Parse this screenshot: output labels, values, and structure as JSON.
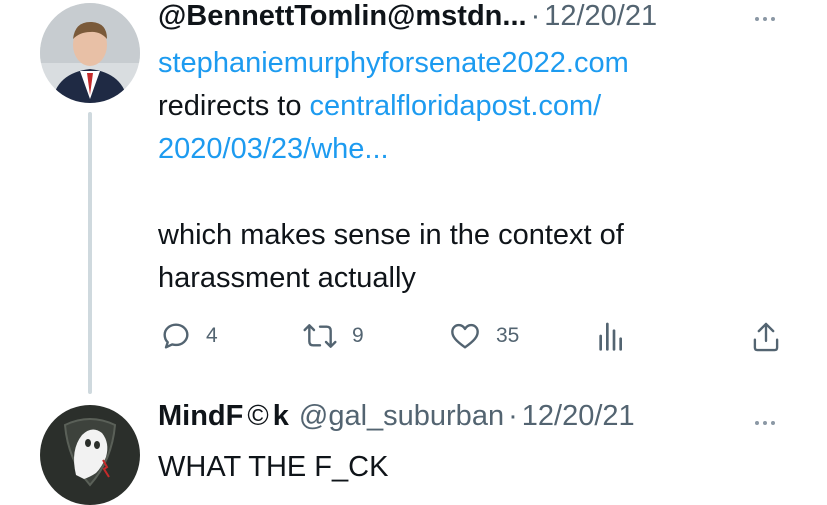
{
  "tweet1": {
    "display_name": "@BennettTomlin@mstdn...",
    "separator": "·",
    "date": "12/20/21",
    "body": {
      "link1": "stephaniemurphyforsenate2022.com",
      "text_redirects": "redirects to ",
      "link2_part1": "centralfloridapost.com/",
      "link2_part2": "2020/03/23/whe...",
      "text_line1": "which makes sense in the context of",
      "text_line2": "harassment actually"
    },
    "actions": {
      "replies": "4",
      "retweets": "9",
      "likes": "35"
    },
    "icons": [
      "more-icon",
      "reply-icon",
      "retweet-icon",
      "like-icon",
      "analytics-icon",
      "share-icon"
    ]
  },
  "tweet2": {
    "display_name_part1": "MindF",
    "display_name_symbol": "©",
    "display_name_part2": "k",
    "handle": "@gal_suburban",
    "separator": "·",
    "date": "12/20/21",
    "body": "WHAT THE F_CK"
  },
  "colors": {
    "link": "#1d9bf0",
    "secondary_text": "#536471",
    "primary_text": "#0f1419",
    "thread_line": "#cfd9de"
  }
}
